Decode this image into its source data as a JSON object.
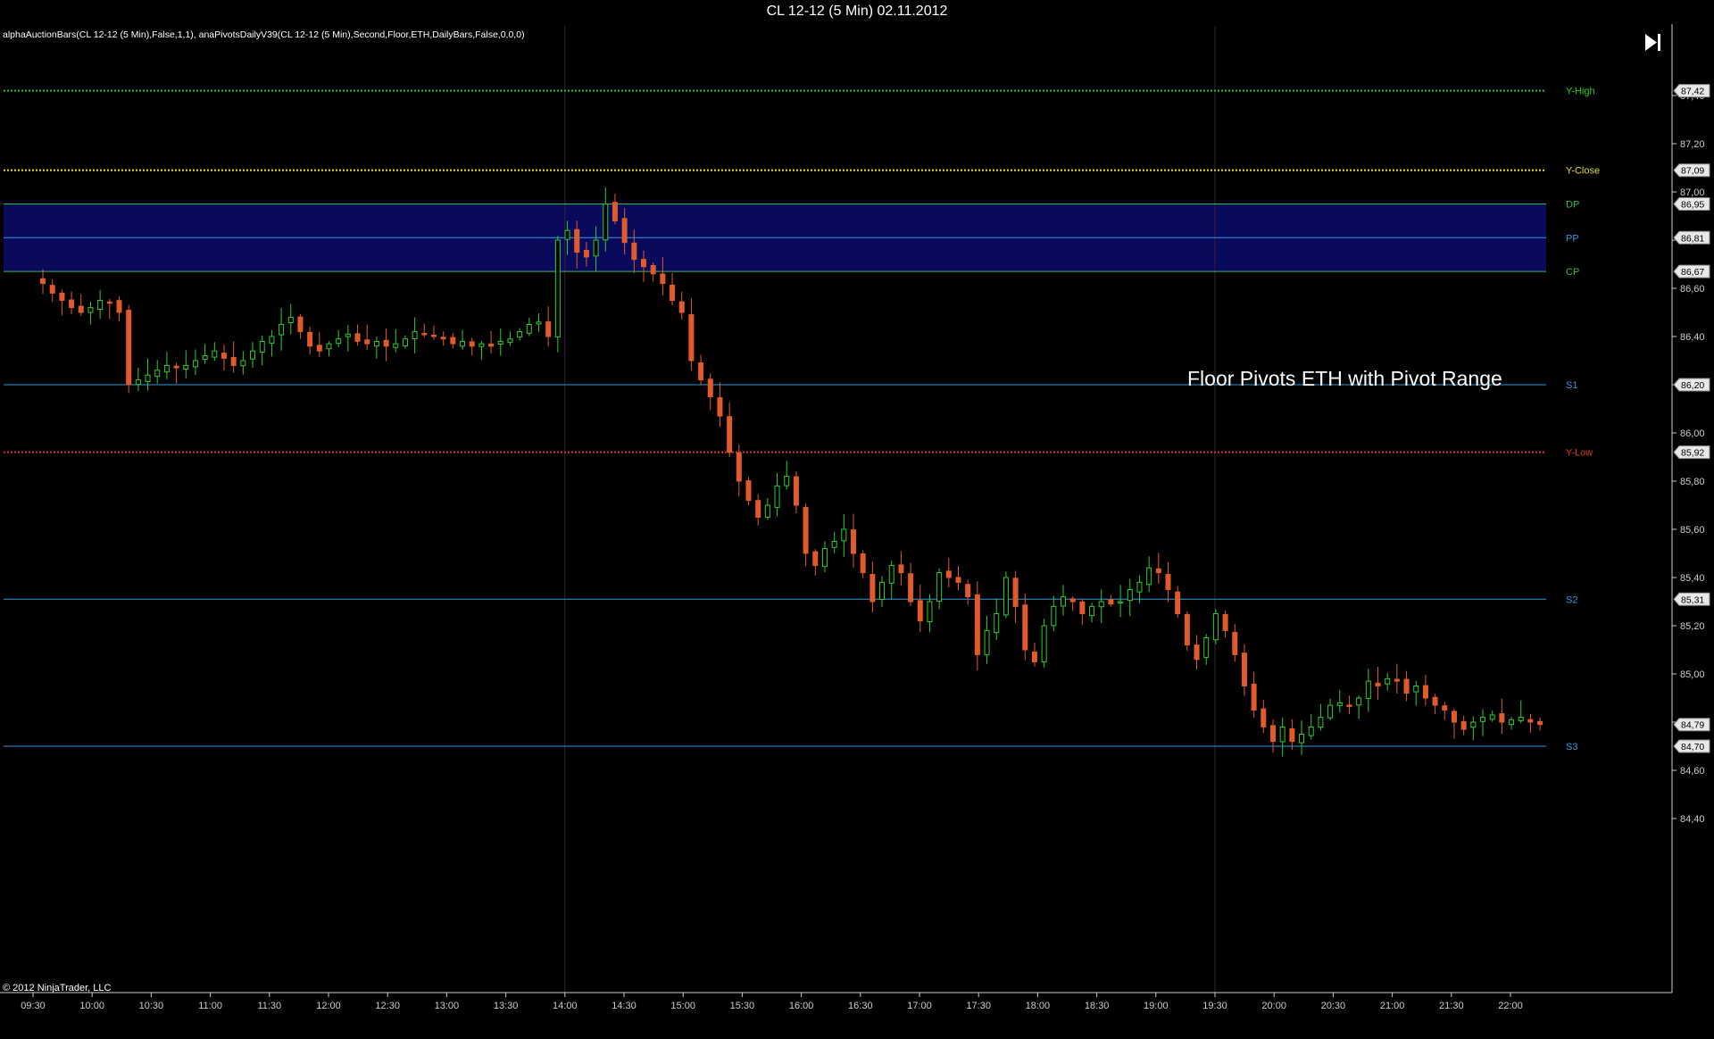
{
  "window": {
    "title": "CL 12-12 (5 Min)  02.11.2012"
  },
  "indicator_label": "alphaAuctionBars(CL 12-12 (5 Min),False,1,1), anaPivotsDailyV39(CL 12-12 (5 Min),Second,Floor,ETH,DailyBars,False,0,0,0)",
  "copyright": "© 2012 NinjaTrader, LLC",
  "annotation": "Floor Pivots ETH with Pivot Range",
  "nav_button": {
    "icon": "skip-to-end-icon"
  },
  "colors": {
    "background": "#000000",
    "up_candle": "#2ecc2e",
    "down_candle": "#e05a2a",
    "pivot_range_fill": "#0a0a5c",
    "y_high": "#22cc22",
    "y_close": "#dddd22",
    "y_low": "#dd3322",
    "pivot_blue": "#3399dd",
    "dp_cp_green": "#33bb55"
  },
  "chart_data": {
    "type": "line",
    "title": "CL 12-12 (5 Min)  02.11.2012",
    "y_ticks": [
      "87,40",
      "87,20",
      "87,00",
      "86,80",
      "86,60",
      "86,40",
      "86,20",
      "86,00",
      "85,80",
      "85,60",
      "85,40",
      "85,20",
      "85,00",
      "84,80",
      "84,60",
      "84,40"
    ],
    "ylim": [
      84.35,
      87.5
    ],
    "x_ticks": [
      "09:30",
      "10:00",
      "10:30",
      "11:00",
      "11:30",
      "12:00",
      "12:30",
      "13:00",
      "13:30",
      "14:00",
      "14:30",
      "15:00",
      "15:30",
      "16:00",
      "16:30",
      "17:00",
      "17:30",
      "18:00",
      "18:30",
      "19:00",
      "19:30",
      "20:00",
      "20:30",
      "21:00",
      "21:30",
      "22:00"
    ],
    "session_dividers": [
      "14:00",
      "19:30"
    ],
    "levels": [
      {
        "name": "Y-High",
        "value": 87.42,
        "value_label": "87,42",
        "style": "dotted",
        "color": "#22cc22"
      },
      {
        "name": "Y-Close",
        "value": 87.09,
        "value_label": "87,09",
        "style": "dotted",
        "color": "#dddd22"
      },
      {
        "name": "DP",
        "value": 86.95,
        "value_label": "86,95",
        "style": "solid",
        "color": "#33bb55"
      },
      {
        "name": "PP",
        "value": 86.81,
        "value_label": "86,81",
        "style": "solid",
        "color": "#3399dd"
      },
      {
        "name": "CP",
        "value": 86.67,
        "value_label": "86,67",
        "style": "solid",
        "color": "#33bb55"
      },
      {
        "name": "S1",
        "value": 86.2,
        "value_label": "86,20",
        "style": "solid",
        "color": "#3399dd"
      },
      {
        "name": "Y-Low",
        "value": 85.92,
        "value_label": "85,92",
        "style": "dotted",
        "color": "#dd3322"
      },
      {
        "name": "S2",
        "value": 85.31,
        "value_label": "85,31",
        "style": "solid",
        "color": "#3399dd"
      },
      {
        "name": "S3",
        "value": 84.7,
        "value_label": "84,70",
        "style": "solid",
        "color": "#3399dd"
      }
    ],
    "last_price": {
      "value": 84.79,
      "label": "84,79"
    },
    "pivot_range": {
      "top": 86.95,
      "bottom": 86.67
    },
    "close_path": [
      86.62,
      86.58,
      86.55,
      86.52,
      86.5,
      86.52,
      86.55,
      86.54,
      86.5,
      86.2,
      86.22,
      86.24,
      86.26,
      86.28,
      86.27,
      86.28,
      86.3,
      86.32,
      86.34,
      86.31,
      86.28,
      86.3,
      86.34,
      86.38,
      86.4,
      86.45,
      86.48,
      86.42,
      86.36,
      86.34,
      86.37,
      86.39,
      86.41,
      86.38,
      86.37,
      86.38,
      86.36,
      86.37,
      86.39,
      86.42,
      86.41,
      86.4,
      86.39,
      86.37,
      86.38,
      86.36,
      86.37,
      86.36,
      86.38,
      86.39,
      86.42,
      86.45,
      86.46,
      86.4,
      86.8,
      86.84,
      86.75,
      86.73,
      86.8,
      86.95,
      86.88,
      86.79,
      86.72,
      86.69,
      86.66,
      86.62,
      86.55,
      86.5,
      86.3,
      86.22,
      86.15,
      86.07,
      85.92,
      85.8,
      85.72,
      85.65,
      85.7,
      85.78,
      85.82,
      85.7,
      85.5,
      85.45,
      85.52,
      85.55,
      85.6,
      85.5,
      85.42,
      85.3,
      85.38,
      85.45,
      85.42,
      85.3,
      85.22,
      85.3,
      85.42,
      85.4,
      85.38,
      85.32,
      85.08,
      85.18,
      85.25,
      85.4,
      85.28,
      85.1,
      85.05,
      85.2,
      85.28,
      85.32,
      85.3,
      85.25,
      85.28,
      85.3,
      85.29,
      85.3,
      85.35,
      85.38,
      85.44,
      85.42,
      85.35,
      85.25,
      85.12,
      85.06,
      85.15,
      85.25,
      85.18,
      85.08,
      84.95,
      84.85,
      84.78,
      84.72,
      84.78,
      84.72,
      84.75,
      84.78,
      84.82,
      84.87,
      84.88,
      84.87,
      84.9,
      84.97,
      84.95,
      84.98,
      84.97,
      84.92,
      84.95,
      84.9,
      84.87,
      84.85,
      84.8,
      84.77,
      84.8,
      84.82,
      84.83,
      84.8,
      84.81,
      84.82,
      84.8,
      84.79
    ]
  }
}
